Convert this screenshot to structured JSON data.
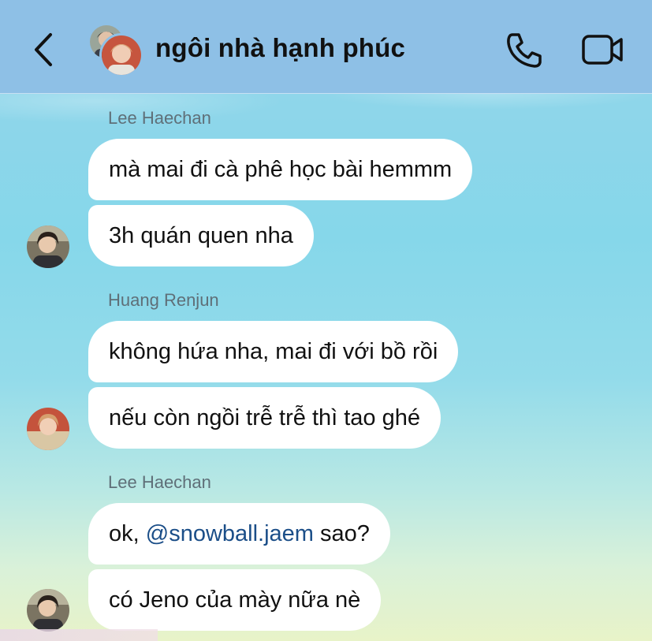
{
  "header": {
    "title": "ngôi nhà hạnh phúc",
    "back_icon": "chevron-left-icon",
    "call_icon": "phone-icon",
    "video_icon": "video-camera-icon"
  },
  "colors": {
    "header_bg": "#8ec0e6",
    "bubble_bg": "#ffffff",
    "mention": "#1b4e88",
    "sender_name": "#5f6f78"
  },
  "messages": [
    {
      "sender": "Lee Haechan",
      "bubbles": [
        "mà mai đi cà phê học bài hemmm",
        "3h quán quen nha"
      ]
    },
    {
      "sender": "Huang Renjun",
      "bubbles": [
        "không hứa nha, mai đi với bồ rồi",
        "nếu còn ngồi trễ trễ thì tao ghé"
      ]
    },
    {
      "sender": "Lee Haechan",
      "bubbles": [
        {
          "prefix": "ok, ",
          "mention": "@snowball.jaem",
          "suffix": " sao?"
        },
        "có Jeno của mày nữa nè"
      ]
    }
  ]
}
